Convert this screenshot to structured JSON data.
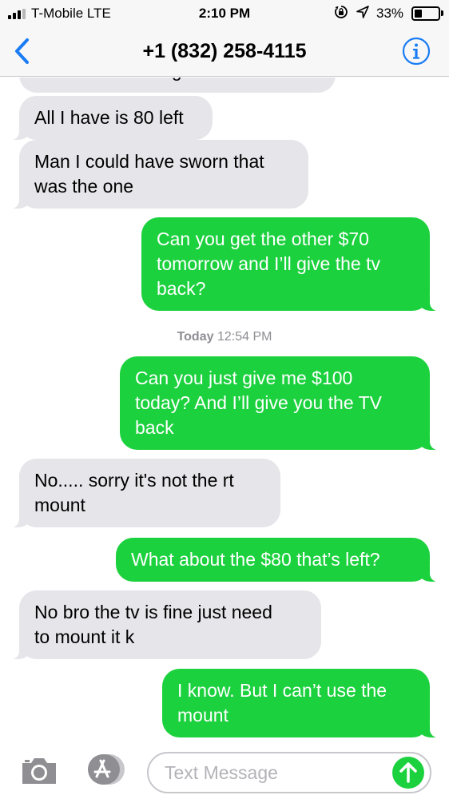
{
  "status_bar": {
    "carrier": "T-Mobile  LTE",
    "time": "2:10 PM",
    "battery_percent": "33%",
    "battery_level": 0.33,
    "signal_bars": 3,
    "icons": [
      "signal-icon",
      "rotation-lock-icon",
      "location-icon",
      "battery-icon"
    ]
  },
  "nav": {
    "back_icon": "chevron-left-icon",
    "title": "+1 (832) 258-4115",
    "info_icon": "info-icon"
  },
  "messages": [
    {
      "dir": "in",
      "text": "house that's all I got brother",
      "clipped": true
    },
    {
      "dir": "in",
      "text": "All I have is 80 left"
    },
    {
      "dir": "in",
      "text": "Man I could have sworn that\nwas the one"
    },
    {
      "dir": "out",
      "text": "Can you get the other $70\ntomorrow and I’ll give the tv\nback?"
    },
    {
      "dir": "out",
      "text": "Can you just give me $100\ntoday? And I’ll give you the TV\nback"
    },
    {
      "dir": "in",
      "text": "No..... sorry it's not the rt\nmount"
    },
    {
      "dir": "out",
      "text": "What about the $80 that’s left?"
    },
    {
      "dir": "in",
      "text": "No bro the tv is fine just need\nto mount it k"
    },
    {
      "dir": "out",
      "text": "I know. But I can’t use the\nmount"
    }
  ],
  "timestamp": {
    "day": "Today",
    "time": "12:54 PM"
  },
  "input_bar": {
    "placeholder": "Text Message",
    "camera_icon": "camera-icon",
    "apps_icon": "app-store-icon",
    "send_icon": "send-arrow-icon",
    "colors": {
      "send": "#1cd13e"
    }
  },
  "colors": {
    "outgoing_bubble": "#1cd13e",
    "incoming_bubble": "#e5e5ea",
    "accent": "#1a7cf4"
  }
}
